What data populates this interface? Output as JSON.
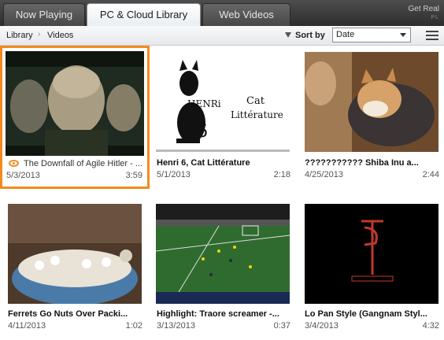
{
  "tabs": [
    {
      "label": "Now Playing",
      "active": false
    },
    {
      "label": "PC & Cloud Library",
      "active": true
    },
    {
      "label": "Web Videos",
      "active": false
    }
  ],
  "brand": {
    "text": "Get Real",
    "sub": "PL"
  },
  "toolbar": {
    "breadcrumb": [
      "Library",
      "Videos"
    ],
    "sort_label": "Sort by",
    "sort_value": "Date"
  },
  "videos": [
    {
      "title": "The Downfall of Agile Hitler - ...",
      "date": "5/3/2013",
      "duration": "3:59",
      "selected": true
    },
    {
      "title": "Henri 6, Cat Littérature",
      "date": "5/1/2013",
      "duration": "2:18",
      "thumb_text": [
        "HENRi",
        "6",
        "Cat",
        "Littérature"
      ]
    },
    {
      "title": "??????????? Shiba Inu a...",
      "date": "4/25/2013",
      "duration": "2:44"
    },
    {
      "title": "Ferrets Go Nuts Over Packi...",
      "date": "4/11/2013",
      "duration": "1:02"
    },
    {
      "title": "Highlight: Traore screamer -...",
      "date": "3/13/2013",
      "duration": "0:37"
    },
    {
      "title": "Lo Pan Style (Gangnam Styl...",
      "date": "3/4/2013",
      "duration": "4:32"
    }
  ],
  "colors": {
    "selection": "#f48a1d",
    "active_tab": "#ffffff"
  }
}
